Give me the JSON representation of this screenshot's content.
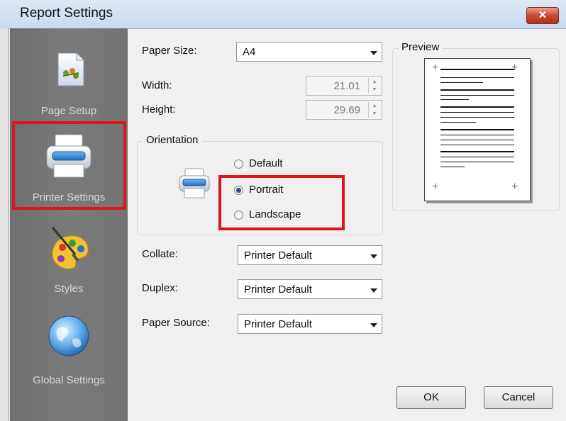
{
  "window": {
    "title": "Report Settings",
    "close_glyph": "✕"
  },
  "sidebar": {
    "items": [
      {
        "label": "Page Setup",
        "icon": "page-setup-icon"
      },
      {
        "label": "Printer Settings",
        "icon": "printer-icon",
        "selected": true
      },
      {
        "label": "Styles",
        "icon": "palette-brush-icon"
      },
      {
        "label": "Global Settings",
        "icon": "globe-icon"
      }
    ]
  },
  "form": {
    "paper_size": {
      "label": "Paper Size:",
      "value": "A4"
    },
    "width": {
      "label": "Width:",
      "value": "21.01"
    },
    "height": {
      "label": "Height:",
      "value": "29.69"
    },
    "orientation": {
      "label": "Orientation",
      "options": [
        "Default",
        "Portrait",
        "Landscape"
      ],
      "selected": "Portrait"
    },
    "collate": {
      "label": "Collate:",
      "value": "Printer Default"
    },
    "duplex": {
      "label": "Duplex:",
      "value": "Printer Default"
    },
    "paper_source": {
      "label": "Paper Source:",
      "value": "Printer Default"
    }
  },
  "preview": {
    "label": "Preview"
  },
  "buttons": {
    "ok": "OK",
    "cancel": "Cancel"
  },
  "colors": {
    "highlight": "#e0141e",
    "sidebar": "#737373",
    "dialog": "#f0f0f0"
  }
}
